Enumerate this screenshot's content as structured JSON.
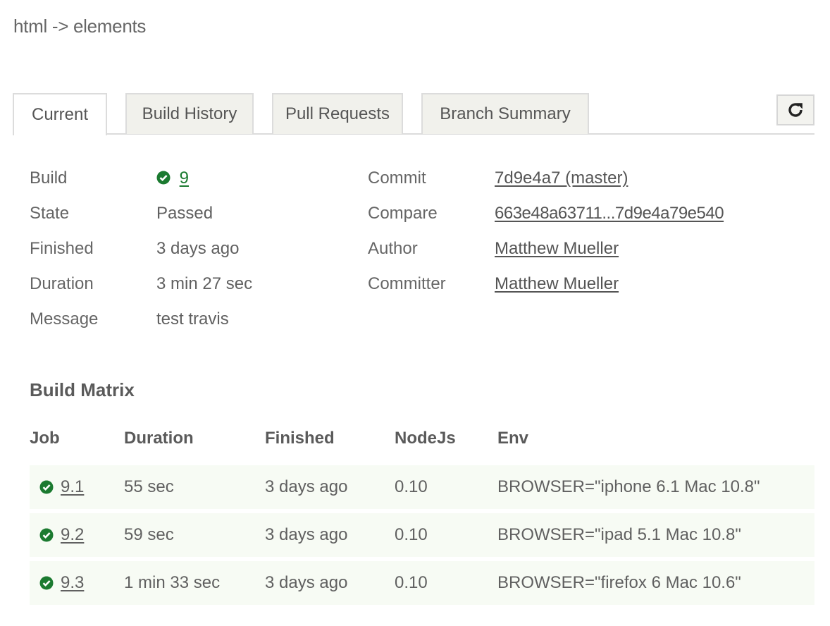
{
  "repo": {
    "title": "html -> elements"
  },
  "tabs": [
    {
      "label": "Current"
    },
    {
      "label": "Build History"
    },
    {
      "label": "Pull Requests"
    },
    {
      "label": "Branch Summary"
    }
  ],
  "summary": {
    "build_label": "Build",
    "build_value": "9",
    "state_label": "State",
    "state_value": "Passed",
    "finished_label": "Finished",
    "finished_value": "3 days ago",
    "duration_label": "Duration",
    "duration_value": "3 min 27 sec",
    "message_label": "Message",
    "message_value": "test travis",
    "commit_label": "Commit",
    "commit_value": "7d9e4a7 (master)",
    "compare_label": "Compare",
    "compare_value": "663e48a63711...7d9e4a79e540",
    "author_label": "Author",
    "author_value": "Matthew Mueller",
    "committer_label": "Committer",
    "committer_value": "Matthew Mueller"
  },
  "matrix": {
    "title": "Build Matrix",
    "headers": [
      "Job",
      "Duration",
      "Finished",
      "NodeJs",
      "Env"
    ],
    "rows": [
      {
        "job": "9.1",
        "duration": "55 sec",
        "finished": "3 days ago",
        "nodejs": "0.10",
        "env": "BROWSER=\"iphone 6.1 Mac 10.8\""
      },
      {
        "job": "9.2",
        "duration": "59 sec",
        "finished": "3 days ago",
        "nodejs": "0.10",
        "env": "BROWSER=\"ipad 5.1 Mac 10.8\""
      },
      {
        "job": "9.3",
        "duration": "1 min 33 sec",
        "finished": "3 days ago",
        "nodejs": "0.10",
        "env": "BROWSER=\"firefox 6 Mac 10.6\""
      }
    ]
  },
  "colors": {
    "success": "#1b7a30",
    "row_background": "#f7fbf4",
    "tab_inactive": "#f1f1ec"
  },
  "icons": {
    "refresh": "refresh-icon",
    "status": "check-circle-icon"
  }
}
